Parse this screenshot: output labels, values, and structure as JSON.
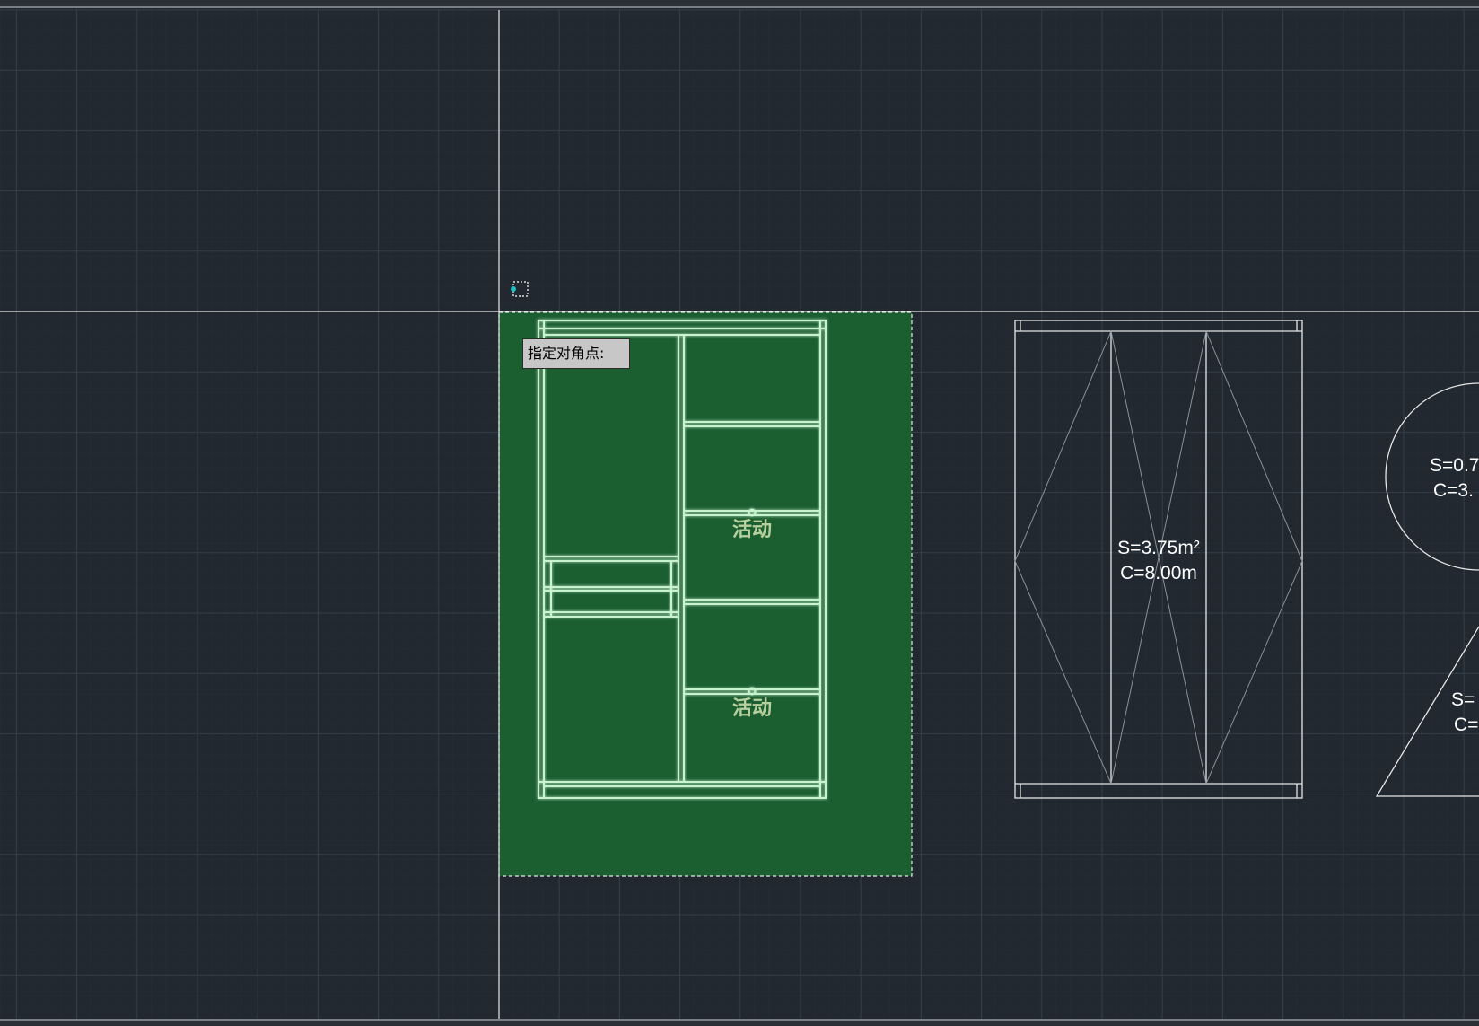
{
  "app": {
    "type": "CAD drawing canvas"
  },
  "colors": {
    "background": "#212830",
    "grid_minor": "#2a323b",
    "grid_major": "#39424c",
    "crosshair": "#e6e6e6",
    "selection_fill": "#1b5e30",
    "selection_border": "#e6e6e6",
    "highlight_line": "#c9f2cf",
    "label_on_selection": "#b7cf9d",
    "drawing_line": "#e6e6e6"
  },
  "command_prompt": {
    "text": "指定对角点:"
  },
  "cursor": {
    "icon": "pickbox-cursor-icon"
  },
  "wardrobe_selected": {
    "label_upper": "活动",
    "label_lower": "活动"
  },
  "wardrobe_plain": {
    "area_text": "S=3.75m²",
    "perimeter_text": "C=8.00m"
  },
  "circle_shape": {
    "area_text": "S=0.7",
    "perimeter_text": "C=3."
  },
  "triangle_shape": {
    "area_text": "S=",
    "perimeter_text": "C="
  }
}
